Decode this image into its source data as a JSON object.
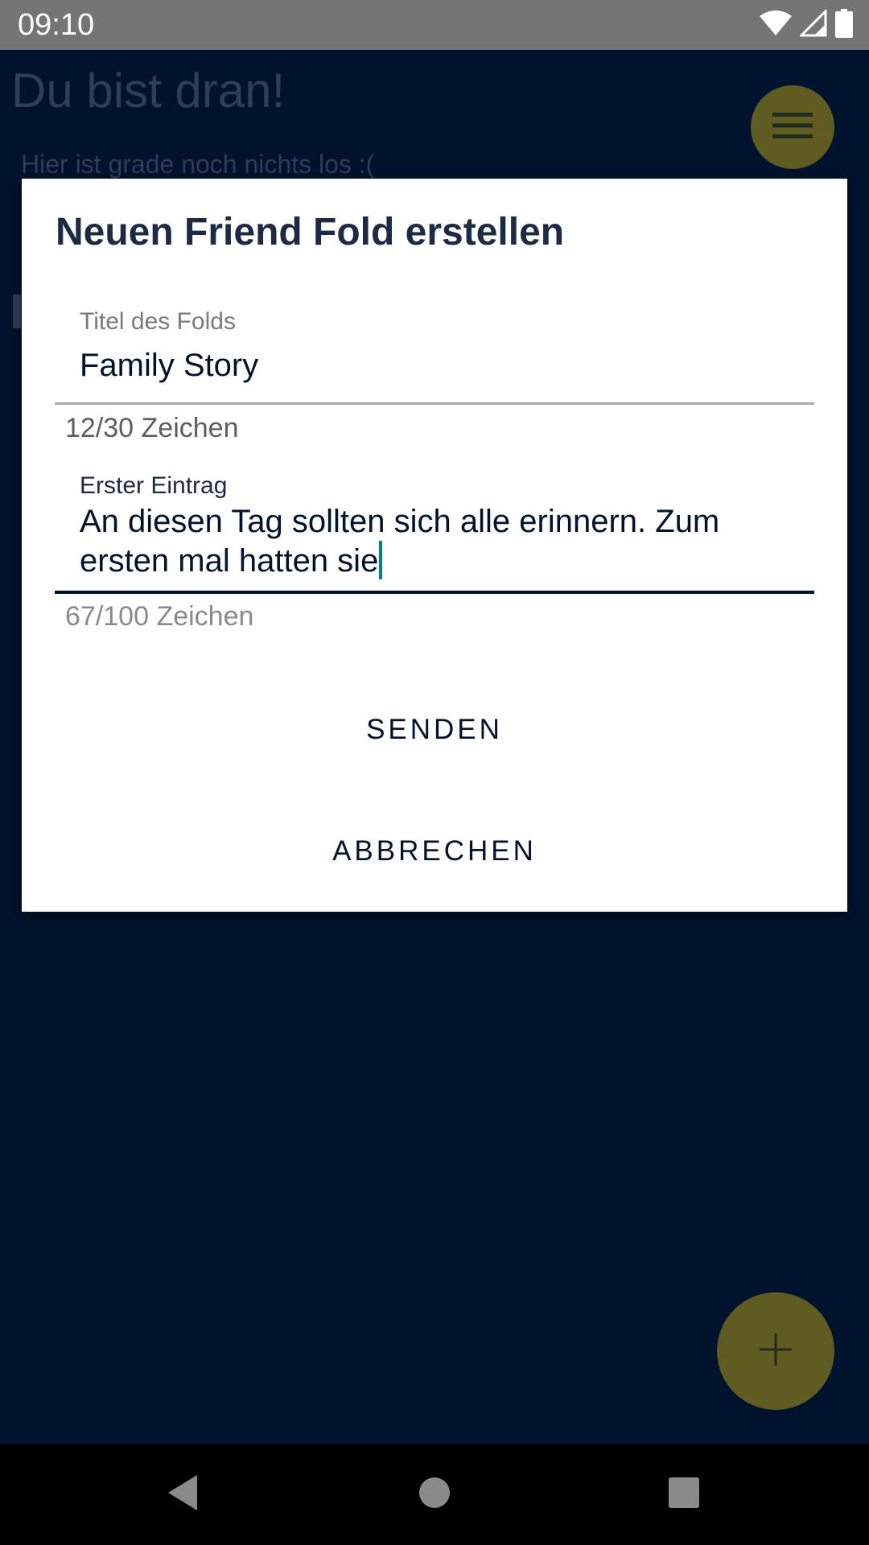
{
  "status_bar": {
    "time": "09:10",
    "icons": [
      "wifi-icon",
      "signal-icon",
      "battery-icon"
    ]
  },
  "background": {
    "title": "Du bist dran!",
    "subtitle": "Hier ist grade noch nichts los :(",
    "menu_icon": "hamburger-menu-icon",
    "fab_icon": "plus-icon"
  },
  "dialog": {
    "title": "Neuen Friend Fold erstellen",
    "title_field": {
      "label": "Titel des Folds",
      "value": "Family Story",
      "counter": "12/30 Zeichen"
    },
    "entry_field": {
      "label": "Erster Eintrag",
      "value": "An diesen Tag sollten sich alle erinnern. Zum ersten mal hatten sie",
      "counter": "67/100 Zeichen"
    },
    "send_label": "SENDEN",
    "cancel_label": "ABBRECHEN"
  },
  "nav_bar": {
    "icons": [
      "back-icon",
      "home-icon",
      "recent-apps-icon"
    ]
  },
  "colors": {
    "background": "#00132e",
    "accent": "#5f5b21",
    "cursor": "#00897b",
    "dialog": "#ffffff"
  }
}
